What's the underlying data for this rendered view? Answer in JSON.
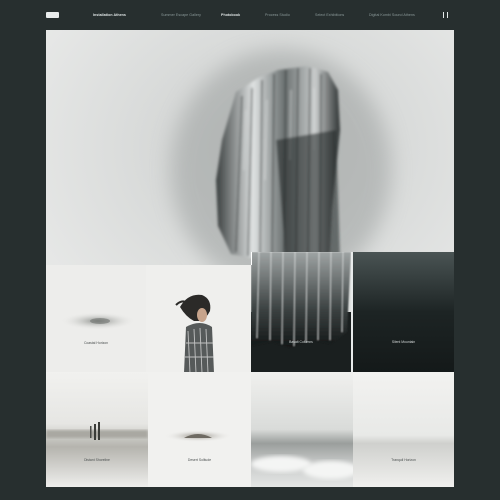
{
  "nav": {
    "items": [
      {
        "label": "Installation Athens",
        "bold": true
      },
      {
        "label": "Summer Escape Gallery",
        "bold": false
      },
      {
        "label": "Photobook",
        "bold": true
      },
      {
        "label": "Process Studio",
        "bold": false
      },
      {
        "label": "Select Exhibitions",
        "bold": false
      },
      {
        "label": "Digital Kombi Sound Athens",
        "bold": false
      }
    ]
  },
  "gallery": {
    "tiles": [
      {
        "caption": ""
      },
      {
        "caption": "Coastal Horizon"
      },
      {
        "caption": ""
      },
      {
        "caption": "Basalt Columns"
      },
      {
        "caption": "Silent Mountain"
      },
      {
        "caption": "Distant Shoreline"
      },
      {
        "caption": "Desert Solitude"
      },
      {
        "caption": ""
      },
      {
        "caption": "Tranquil Horizon"
      }
    ]
  },
  "colors": {
    "background": "#272f2f",
    "paper": "#f0f0ee",
    "dark_tile": "#1c2222"
  }
}
